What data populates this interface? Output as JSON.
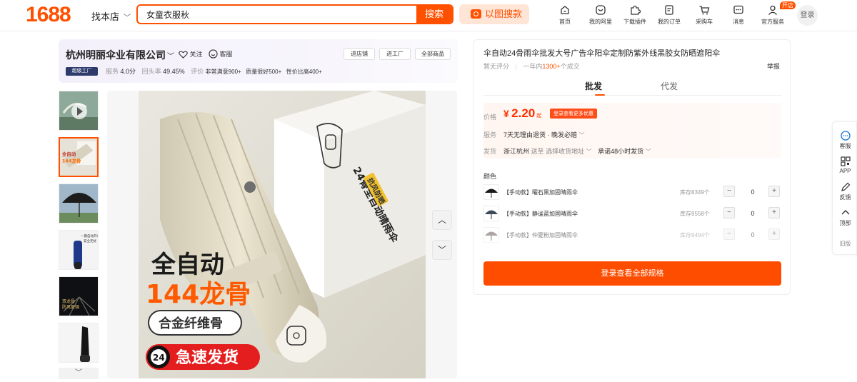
{
  "header": {
    "logo": "1688",
    "find_store": "找本店",
    "search_value": "女童衣服秋",
    "search_button": "搜索",
    "image_search": "以图搜款",
    "nav": [
      "首页",
      "我的阿里",
      "下载插件",
      "我的订单",
      "采购车",
      "消息",
      "官方服务"
    ],
    "open_badge": "开店",
    "login": "登录"
  },
  "shop": {
    "name": "杭州明丽伞业有限公司",
    "follow": "关注",
    "service": "客服",
    "buttons": [
      "进店铺",
      "进工厂",
      "全部商品"
    ],
    "badge": "超级工厂",
    "stats_service_label": "服务",
    "stats_service_value": "4.0分",
    "stats_return_label": "回头率",
    "stats_return_value": "49.45%",
    "stats_review_label": "评价",
    "reviews": [
      "非常满意900+",
      "质量很好500+",
      "性价比高400+"
    ]
  },
  "gallery": {
    "thumb_texts": [
      "",
      "全自动\n144龙骨",
      "",
      "一键自动开收\n安全无忧",
      "双龙骨\n防风更强",
      ""
    ],
    "main_text_line1": "全自动",
    "main_text_line2": "144龙骨",
    "main_text_line3": "合金纤维骨",
    "main_badge_num": "24",
    "main_text_line4": "急速发货",
    "box_text": "24骨全自动晴雨伞",
    "box_label": "抗风防晒"
  },
  "product": {
    "title": "伞自动24骨雨伞批发大号广告伞阳伞定制防紫外线黑胶女防晒遮阳伞",
    "rating": "暂无评分",
    "sold_prefix": "一年内",
    "sold_count": "1300+",
    "sold_suffix": "个成交",
    "report": "举报",
    "tab_wholesale": "批发",
    "tab_dropship": "代发",
    "price_label": "价格",
    "price_currency": "¥",
    "price_value": "2.20",
    "price_unit": "起",
    "promo": "登录查看更多优惠",
    "service_label": "服务",
    "service_value": "7天无理由退货 · 晚发必赔",
    "ship_label": "发货",
    "ship_from": "浙江杭州",
    "ship_to": "送至",
    "ship_choose": "选择收货地址",
    "ship_promise": "承诺48小时发货",
    "color_label": "颜色",
    "skus": [
      {
        "name": "【手动款】曜石黑加固晴雨伞",
        "stock": "库存8349个",
        "qty": "0"
      },
      {
        "name": "【手动款】静谧蓝加固晴雨伞",
        "stock": "库存9558个",
        "qty": "0"
      },
      {
        "name": "【手动款】仲夏粉加固晴雨伞",
        "stock": "库存9494个",
        "qty": "0"
      }
    ],
    "view_all": "登录查看全部规格"
  },
  "sidebar": [
    "客服",
    "APP",
    "反馈",
    "顶部",
    "旧版"
  ],
  "colors": {
    "brand": "#ff5000",
    "price": "#ff2f00"
  }
}
